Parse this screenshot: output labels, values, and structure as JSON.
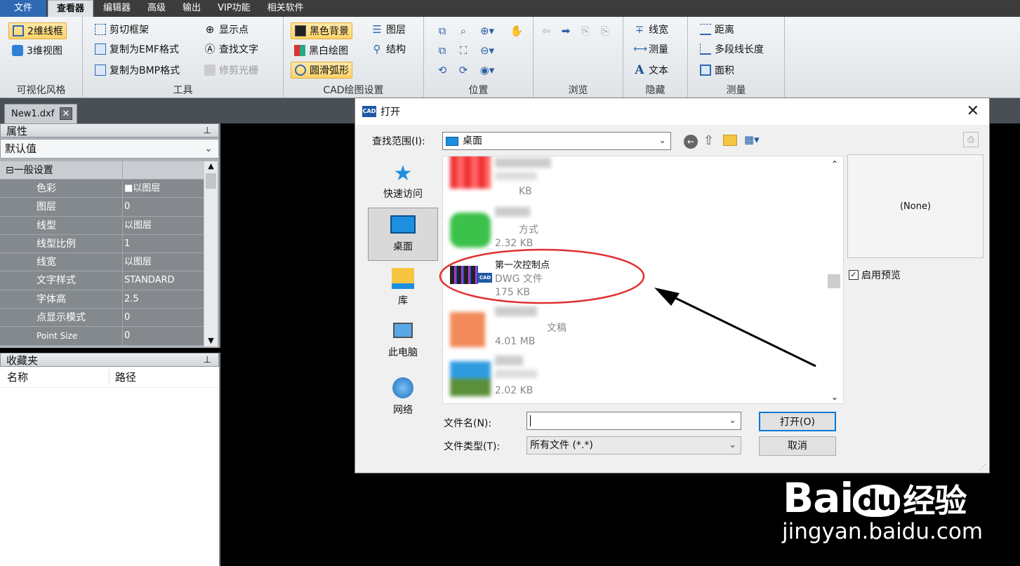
{
  "menu": {
    "items": [
      "文件",
      "查看器",
      "编辑器",
      "高级",
      "输出",
      "VIP功能",
      "相关软件"
    ],
    "active_index": 1
  },
  "ribbon": {
    "visual": {
      "label": "可视化风格",
      "btn_2d": "2维线框",
      "btn_3d": "3维视图"
    },
    "tools": {
      "label": "工具",
      "clip_frame": "剪切框架",
      "copy_emf": "复制为EMF格式",
      "copy_bmp": "复制为BMP格式",
      "show_points": "显示点",
      "find_text": "查找文字",
      "trim_raster": "修剪光栅"
    },
    "cad": {
      "label": "CAD绘图设置",
      "black_bg": "黑色背景",
      "bw_draw": "黑白绘图",
      "smooth_arc": "圆滑弧形",
      "layers": "图层",
      "structure": "结构"
    },
    "position": {
      "label": "位置"
    },
    "browse": {
      "label": "浏览"
    },
    "hide": {
      "label": "隐藏",
      "line_width": "线宽",
      "measure": "测量",
      "text": "文本"
    },
    "measure": {
      "label": "测量",
      "distance": "距离",
      "polyline_length": "多段线长度",
      "area": "面积"
    }
  },
  "document_tab": {
    "name": "New1.dxf"
  },
  "properties": {
    "title": "属性",
    "dropdown_value": "默认值",
    "section": "一般设置",
    "rows": [
      {
        "key": "色彩",
        "value": "■以图层"
      },
      {
        "key": "图层",
        "value": "0"
      },
      {
        "key": "线型",
        "value": "以图层"
      },
      {
        "key": "线型比例",
        "value": "1"
      },
      {
        "key": "线宽",
        "value": "以图层"
      },
      {
        "key": "文字样式",
        "value": "STANDARD"
      },
      {
        "key": "字体高",
        "value": "2.5"
      },
      {
        "key": "点显示模式",
        "value": "0"
      },
      {
        "key": "Point Size",
        "value": "0"
      }
    ]
  },
  "favorites": {
    "title": "收藏夹",
    "col_name": "名称",
    "col_path": "路径"
  },
  "dialog": {
    "title": "打开",
    "lookin_label": "查找范围(I):",
    "lookin_value": "桌面",
    "places": [
      "快速访问",
      "桌面",
      "库",
      "此电脑",
      "网络"
    ],
    "files": [
      {
        "name": "",
        "type": "",
        "size": "KB"
      },
      {
        "name": "",
        "type": "方式",
        "size": "2.32 KB"
      },
      {
        "name": "第一次控制点",
        "type": "DWG 文件",
        "size": "175 KB"
      },
      {
        "name": "",
        "type": "文稿",
        "size": "4.01 MB"
      },
      {
        "name": "",
        "type": "",
        "size": "2.02 KB"
      }
    ],
    "preview_text": "(None)",
    "enable_preview": "启用预览",
    "filename_label": "文件名(N):",
    "filetype_label": "文件类型(T):",
    "filetype_value": "所有文件 (*.*)",
    "open_button": "打开(O)",
    "cancel_button": "取消"
  },
  "watermark": {
    "brand": "Bai",
    "brand2": "du",
    "suffix": "经验",
    "url": "jingyan.baidu.com"
  },
  "colors": {
    "accent": "#0078d7",
    "highlight": "#ffd36a",
    "annotation_red": "#e03030"
  }
}
